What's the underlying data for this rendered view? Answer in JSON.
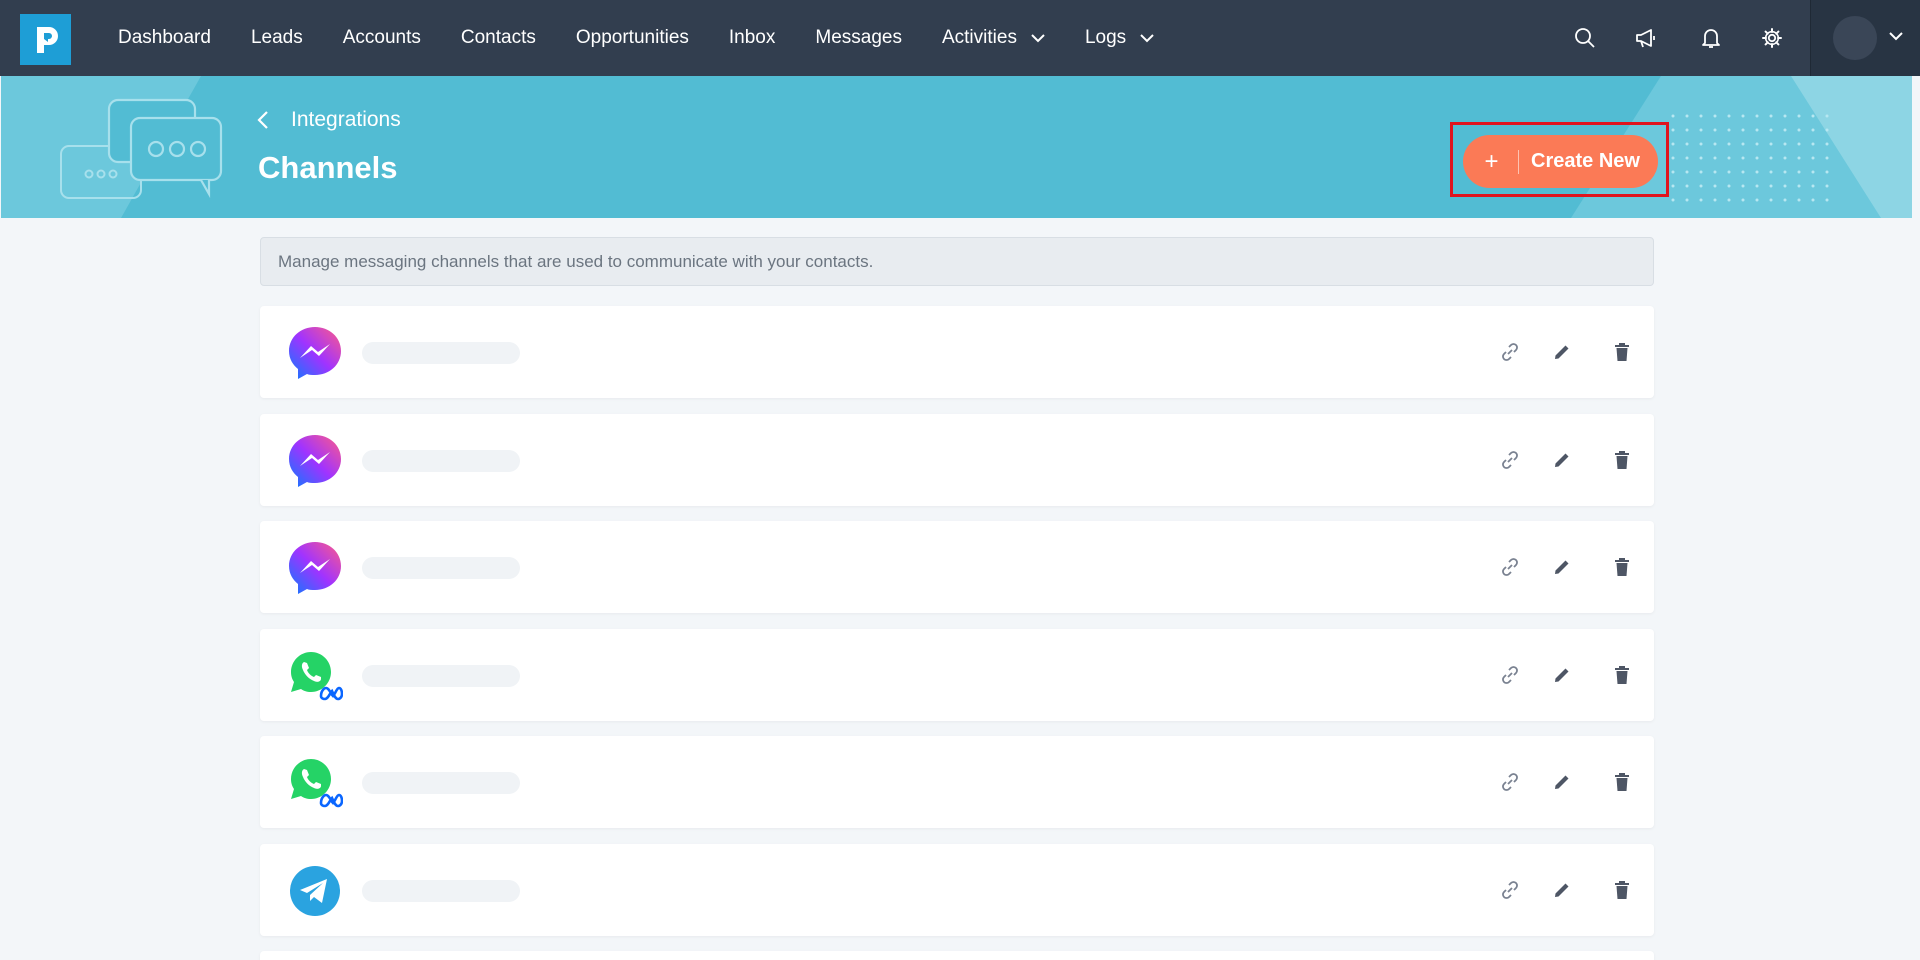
{
  "nav": {
    "items": [
      {
        "label": "Dashboard"
      },
      {
        "label": "Leads"
      },
      {
        "label": "Accounts"
      },
      {
        "label": "Contacts"
      },
      {
        "label": "Opportunities"
      },
      {
        "label": "Inbox"
      },
      {
        "label": "Messages"
      },
      {
        "label": "Activities"
      },
      {
        "label": "Logs"
      }
    ],
    "icons": [
      "search-icon",
      "megaphone-icon",
      "bell-icon",
      "gear-icon"
    ]
  },
  "header": {
    "back_label": "Integrations",
    "title": "Channels",
    "create_button_icon": "+",
    "create_button_label": "Create New"
  },
  "info": {
    "text": "Manage messaging channels that are used to communicate with your contacts."
  },
  "channels": [
    {
      "type": "messenger"
    },
    {
      "type": "messenger"
    },
    {
      "type": "messenger"
    },
    {
      "type": "whatsapp"
    },
    {
      "type": "whatsapp"
    },
    {
      "type": "telegram"
    }
  ],
  "colors": {
    "nav_bg": "#323e4f",
    "banner_bg": "#52bcd3",
    "accent": "#fb7a56",
    "highlight": "#e0141e",
    "logo": "#1e9ed6"
  }
}
